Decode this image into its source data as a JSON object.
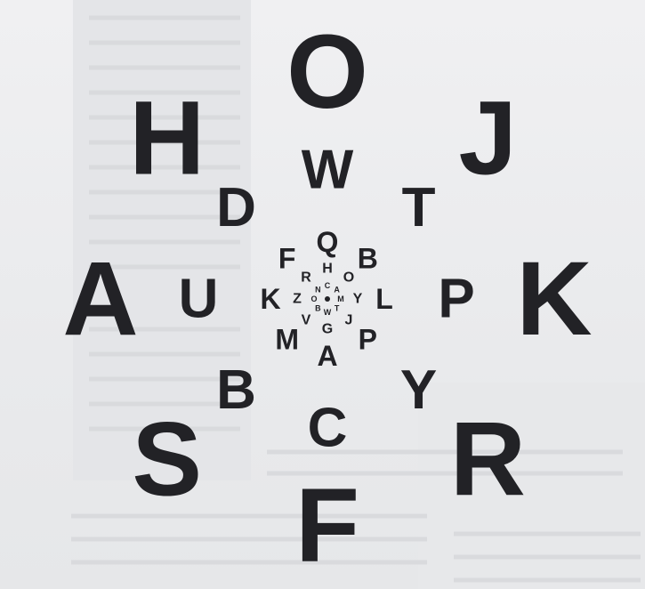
{
  "figure": {
    "kind": "letter-acuity-chart",
    "ink_color": "#222226",
    "paper_color": "#ecedef",
    "rings": [
      {
        "letters": [
          "O",
          "J",
          "K",
          "R",
          "F",
          "S",
          "A",
          "H"
        ]
      },
      {
        "letters": [
          "W",
          "T",
          "P",
          "Y",
          "C",
          "B",
          "U",
          "D"
        ]
      },
      {
        "letters": [
          "Q",
          "B",
          "L",
          "P",
          "A",
          "M",
          "K",
          "F"
        ]
      },
      {
        "letters": [
          "H",
          "O",
          "Y",
          "J",
          "G",
          "V",
          "Z",
          "R"
        ]
      },
      {
        "letters": [
          "C",
          "A",
          "M",
          "T",
          "W",
          "B",
          "O",
          "N"
        ]
      }
    ]
  }
}
